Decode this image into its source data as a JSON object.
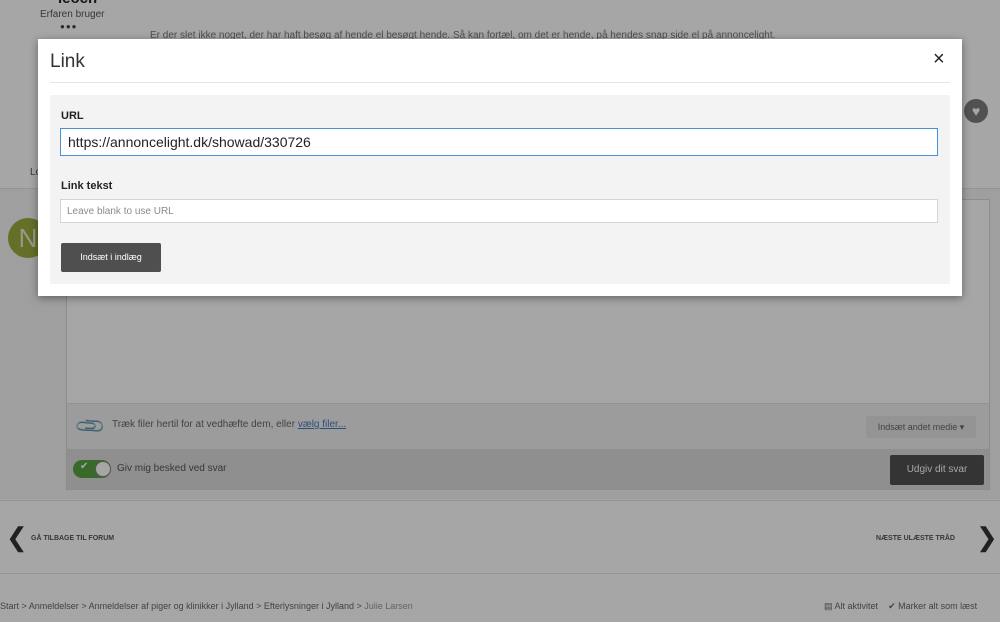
{
  "background": {
    "author": {
      "name": "ieoch",
      "rank": "Erfaren bruger",
      "dots": "●●●"
    },
    "post_snippet": "Er der slet ikke noget, der har haft besøg af  hende el besøgt hende. Så kan fortæl, om det er hende, på hendes snap side el på annoncelight.",
    "lo_text": "Lo",
    "avatar_letter": "N",
    "attach_text": "Træk filer hertil for at vedhæfte dem, eller ",
    "attach_link": "vælg filer...",
    "media_button": "Indsæt andet medie ▾",
    "notify_label": "Giv mig besked ved svar",
    "submit_button": "Udgiv dit svar",
    "back_label": "GÅ TILBAGE TIL FORUM",
    "next_label": "NÆSTE ULÆSTE TRÅD",
    "breadcrumb": {
      "items": [
        "Start",
        "Anmeldelser",
        "Anmeldelser af piger og klinikker i Jylland",
        "Efterlysninger i Jylland"
      ],
      "separator": " > ",
      "current": "Julie Larsen"
    },
    "footer_actions": {
      "activity": "Alt aktivitet",
      "mark_read": "Marker alt som læst"
    }
  },
  "modal": {
    "title": "Link",
    "close_symbol": "×",
    "url_label": "URL",
    "url_value": "https://annoncelight.dk/showad/330726",
    "link_text_label": "Link tekst",
    "link_text_value": "",
    "link_text_placeholder": "Leave blank to use URL",
    "insert_button": "Indsæt i indlæg"
  },
  "icons": {
    "heart": "heart-icon",
    "paperclip": "paperclip-icon",
    "back": "chevron-left-icon",
    "next": "chevron-right-icon",
    "close": "close-icon",
    "check": "check-icon",
    "activity": "activity-icon"
  },
  "colors": {
    "overlay": "rgba(0,0,0,0.35)",
    "accent_input_border": "#4a90d9",
    "button_dark": "#4f4f4f",
    "toggle_on": "#58a440",
    "avatar_bg": "#9bab3c"
  }
}
